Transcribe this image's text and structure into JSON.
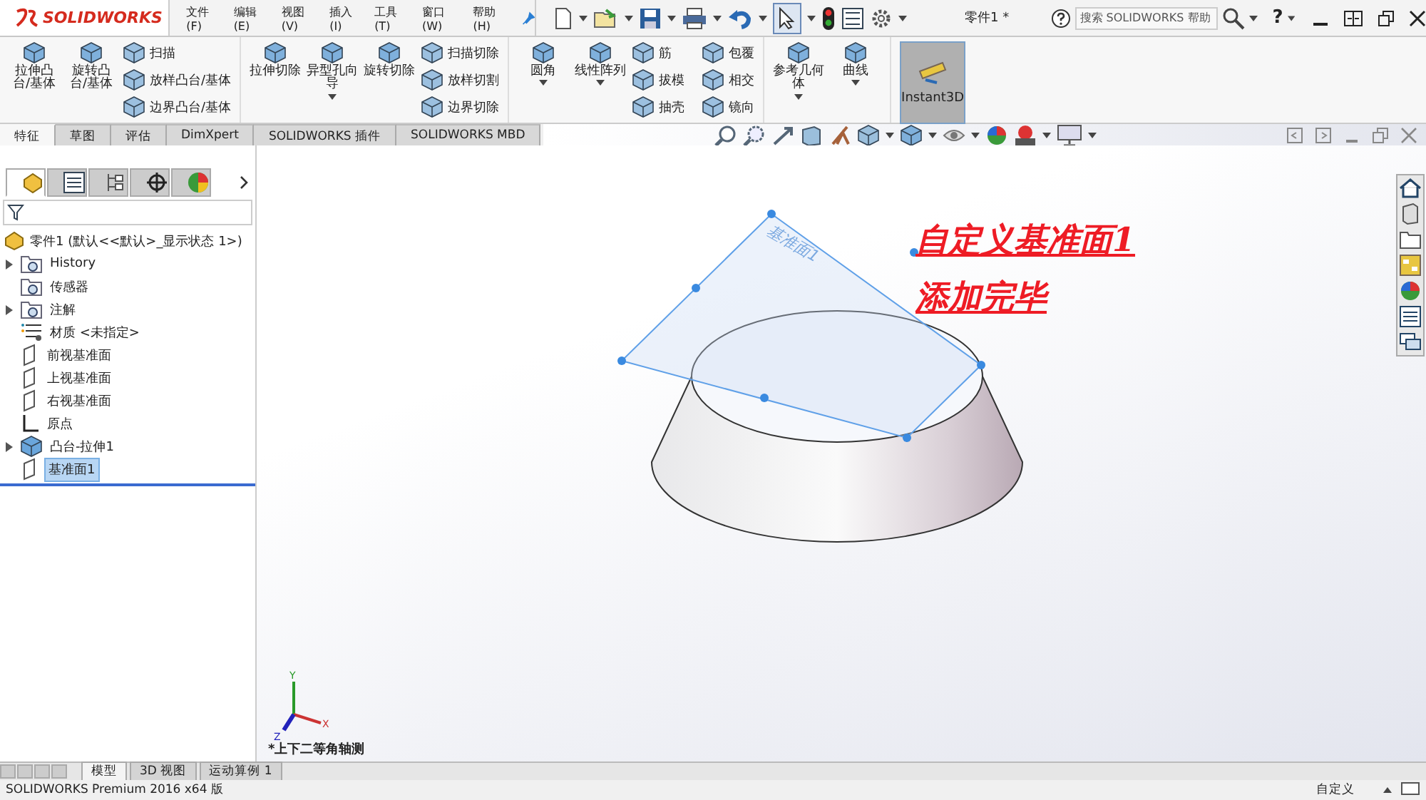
{
  "app": {
    "logo": "SOLIDWORKS"
  },
  "menu": [
    {
      "label": "文件(F)"
    },
    {
      "label": "编辑(E)"
    },
    {
      "label": "视图(V)"
    },
    {
      "label": "插入(I)"
    },
    {
      "label": "工具(T)"
    },
    {
      "label": "窗口(W)"
    },
    {
      "label": "帮助(H)"
    }
  ],
  "document_title": "零件1 *",
  "search": {
    "placeholder": "搜索 SOLIDWORKS 帮助"
  },
  "help_button": "?",
  "ribbon": {
    "groups": [
      {
        "items": [
          {
            "kind": "large",
            "label": "拉伸凸台/基体",
            "dropdown": false
          },
          {
            "kind": "large",
            "label": "旋转凸台/基体",
            "dropdown": false
          },
          {
            "kind": "stack",
            "entries": [
              "扫描",
              "放样凸台/基体",
              "边界凸台/基体"
            ]
          }
        ]
      },
      {
        "items": [
          {
            "kind": "large",
            "label": "拉伸切除",
            "dropdown": false
          },
          {
            "kind": "large",
            "label": "异型孔向导",
            "dropdown": true
          },
          {
            "kind": "large",
            "label": "旋转切除",
            "dropdown": false
          },
          {
            "kind": "stack",
            "entries": [
              "扫描切除",
              "放样切割",
              "边界切除"
            ]
          }
        ]
      },
      {
        "items": [
          {
            "kind": "large",
            "label": "圆角",
            "dropdown": true
          },
          {
            "kind": "large",
            "label": "线性阵列",
            "dropdown": true
          },
          {
            "kind": "stack",
            "entries": [
              "筋",
              "拔模",
              "抽壳"
            ]
          },
          {
            "kind": "stack",
            "entries": [
              "包覆",
              "相交",
              "镜向"
            ]
          }
        ]
      },
      {
        "items": [
          {
            "kind": "large",
            "label": "参考几何体",
            "dropdown": true
          },
          {
            "kind": "large",
            "label": "曲线",
            "dropdown": true
          }
        ]
      },
      {
        "items": [
          {
            "kind": "toggle",
            "label": "Instant3D",
            "selected": true
          }
        ]
      }
    ]
  },
  "command_tabs": [
    {
      "label": "特征",
      "selected": true
    },
    {
      "label": "草图",
      "selected": false
    },
    {
      "label": "评估",
      "selected": false
    },
    {
      "label": "DimXpert",
      "selected": false
    },
    {
      "label": "SOLIDWORKS 插件",
      "selected": false
    },
    {
      "label": "SOLIDWORKS MBD",
      "selected": false
    }
  ],
  "panel_tabs": [
    {
      "kind": "feature-manager",
      "selected": true
    },
    {
      "kind": "property",
      "selected": false
    },
    {
      "kind": "configuration",
      "selected": false
    },
    {
      "kind": "dimxpert",
      "selected": false
    },
    {
      "kind": "display",
      "selected": false
    }
  ],
  "tree": {
    "label": "零件1  (默认<<默认>_显示状态 1>)",
    "kind": "part",
    "children": [
      {
        "label": "History",
        "kind": "history",
        "collapsed": true,
        "selected": false
      },
      {
        "label": "传感器",
        "kind": "sensor",
        "collapsed": false,
        "selected": false
      },
      {
        "label": "注解",
        "kind": "annotation",
        "collapsed": true,
        "selected": false
      },
      {
        "label": "材质 <未指定>",
        "kind": "material",
        "collapsed": false,
        "selected": false
      },
      {
        "label": "前视基准面",
        "kind": "plane",
        "collapsed": false,
        "selected": false
      },
      {
        "label": "上视基准面",
        "kind": "plane",
        "collapsed": false,
        "selected": false
      },
      {
        "label": "右视基准面",
        "kind": "plane",
        "collapsed": false,
        "selected": false
      },
      {
        "label": "原点",
        "kind": "origin",
        "collapsed": false,
        "selected": false
      },
      {
        "label": "凸台-拉伸1",
        "kind": "feature",
        "collapsed": true,
        "selected": false
      },
      {
        "label": "基准面1",
        "kind": "plane",
        "collapsed": false,
        "selected": true
      }
    ]
  },
  "viewport": {
    "plane_label": "基准面1",
    "triad_labels": [
      "Y",
      "X",
      "Z"
    ],
    "annotation": [
      "自定义基准面1",
      "添加完毕"
    ],
    "view_name": "*上下二等角轴测"
  },
  "bottom_tabs": [
    {
      "label": "模型",
      "selected": true
    },
    {
      "label": "3D 视图",
      "selected": false
    },
    {
      "label": "运动算例 1",
      "selected": false
    }
  ],
  "status_bar": {
    "product": "SOLIDWORKS Premium 2016 x64 版",
    "units": "自定义"
  }
}
